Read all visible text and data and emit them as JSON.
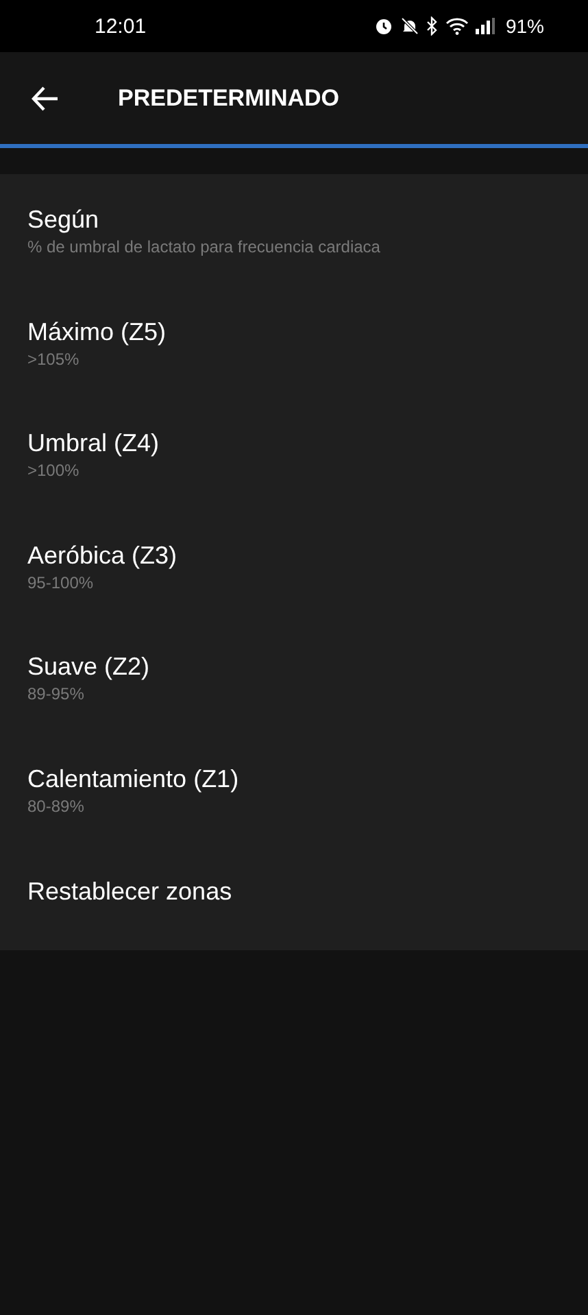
{
  "status_bar": {
    "time": "12:01",
    "battery": "91%"
  },
  "header": {
    "title": "PREDETERMINADO"
  },
  "items": [
    {
      "title": "Según",
      "subtitle": "% de umbral de lactato para frecuencia cardiaca"
    },
    {
      "title": "Máximo (Z5)",
      "subtitle": ">105%"
    },
    {
      "title": "Umbral (Z4)",
      "subtitle": ">100%"
    },
    {
      "title": "Aeróbica (Z3)",
      "subtitle": "95-100%"
    },
    {
      "title": "Suave (Z2)",
      "subtitle": "89-95%"
    },
    {
      "title": "Calentamiento (Z1)",
      "subtitle": "80-89%"
    },
    {
      "title": "Restablecer zonas"
    }
  ]
}
